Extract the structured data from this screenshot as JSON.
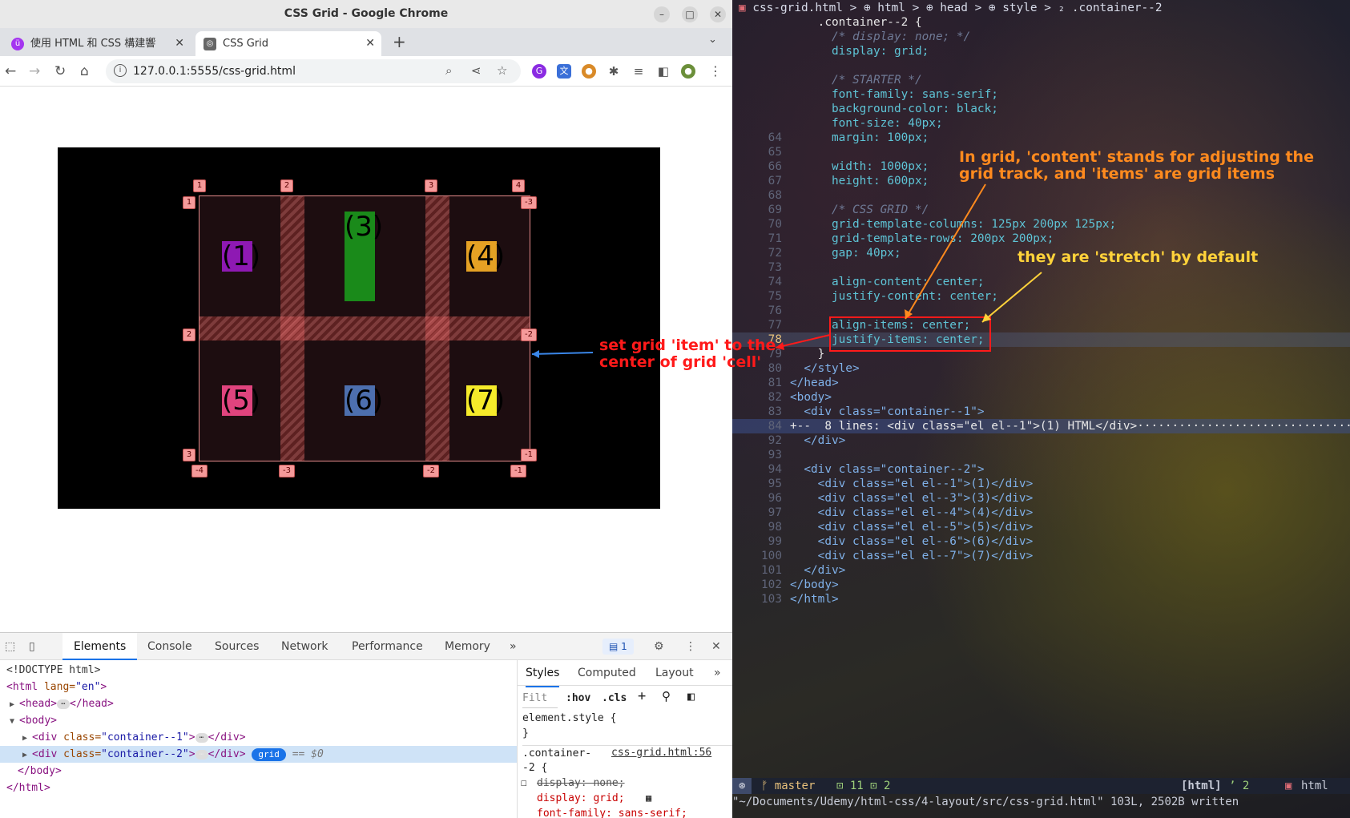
{
  "window": {
    "title": "CSS Grid - Google Chrome"
  },
  "tabs": [
    {
      "label": "使用 HTML 和 CSS 構建響",
      "icon": "udemy-icon"
    },
    {
      "label": "CSS Grid",
      "icon": "page-icon"
    }
  ],
  "address_bar": {
    "url": "127.0.0.1:5555/css-grid.html"
  },
  "grid_items": [
    {
      "label": "(1)",
      "color": "#8e19b3"
    },
    {
      "label": "(3)",
      "color": "#1a8a1a"
    },
    {
      "label": "(4)",
      "color": "#e5a124"
    },
    {
      "label": "(5)",
      "color": "#e0447e"
    },
    {
      "label": "(6)",
      "color": "#4d6fae"
    },
    {
      "label": "(7)",
      "color": "#f5ea2a"
    }
  ],
  "grid_numbers": {
    "top": [
      "1",
      "2",
      "3",
      "4"
    ],
    "left": [
      "1",
      "2",
      "3"
    ],
    "right": [
      "-3",
      "-2",
      "-1"
    ],
    "bottom": [
      "-4",
      "-3",
      "-2",
      "-1"
    ]
  },
  "devtools": {
    "tabs": [
      "Elements",
      "Console",
      "Sources",
      "Network",
      "Performance",
      "Memory"
    ],
    "issues_count": "1",
    "dom": {
      "doctype": "<!DOCTYPE html>",
      "html_open": "<html",
      "html_lang_attr": " lang=",
      "html_lang_val": "\"en\"",
      "html_close_bracket": ">",
      "head": "<head>",
      "head_close": "</head>",
      "body": "<body>",
      "div1_open": "<div",
      "div_class_attr": " class=",
      "div1_class": "\"container--1\"",
      "div2_class": "\"container--2\"",
      "div_close_bracket": ">",
      "div_end": "</div>",
      "grid_badge": "grid",
      "dollar0": "== $0",
      "body_close": "</body>",
      "html_close": "</html>"
    },
    "styles_tabs": [
      "Styles",
      "Computed",
      "Layout"
    ],
    "filter_placeholder": "Filt",
    "hov": ":hov",
    "cls": ".cls",
    "element_style": "element.style {",
    "close_brace": "}",
    "rule_selector_1": ".container-",
    "rule_selector_2": "-2 {",
    "rule_source": "css-grid.html:56",
    "decl_display_none": "display: none;",
    "decl_display_grid": "display: grid;",
    "decl_font_family": "font-family: sans-serif;"
  },
  "editor": {
    "breadcrumb": "css-grid.html > ⊕ html > ⊕ head > ⊕ style > ₂ .container--2",
    "lines": [
      {
        "n": "",
        "t": "    .container--2 {",
        "k": "sel"
      },
      {
        "n": "",
        "t": "      /* display: none; */",
        "k": "cmt"
      },
      {
        "n": "",
        "t": "      display: grid;",
        "k": "decl"
      },
      {
        "n": "",
        "t": "",
        "k": "plain"
      },
      {
        "n": "",
        "t": "      /* STARTER */",
        "k": "cmt"
      },
      {
        "n": "",
        "t": "      font-family: sans-serif;",
        "k": "decl"
      },
      {
        "n": "",
        "t": "      background-color: black;",
        "k": "decl"
      },
      {
        "n": "",
        "t": "      font-size: 40px;",
        "k": "decl"
      },
      {
        "n": "64",
        "t": "      margin: 100px;",
        "k": "decl"
      },
      {
        "n": "65",
        "t": "",
        "k": "plain"
      },
      {
        "n": "66",
        "t": "      width: 1000px;",
        "k": "decl"
      },
      {
        "n": "67",
        "t": "      height: 600px;",
        "k": "decl"
      },
      {
        "n": "68",
        "t": "",
        "k": "plain"
      },
      {
        "n": "69",
        "t": "      /* CSS GRID */",
        "k": "cmt"
      },
      {
        "n": "70",
        "t": "      grid-template-columns: 125px 200px 125px;",
        "k": "decl"
      },
      {
        "n": "71",
        "t": "      grid-template-rows: 200px 200px;",
        "k": "decl"
      },
      {
        "n": "72",
        "t": "      gap: 40px;",
        "k": "decl"
      },
      {
        "n": "73",
        "t": "",
        "k": "plain"
      },
      {
        "n": "74",
        "t": "      align-content: center;",
        "k": "decl"
      },
      {
        "n": "75",
        "t": "      justify-content: center;",
        "k": "decl"
      },
      {
        "n": "76",
        "t": "",
        "k": "plain"
      },
      {
        "n": "77",
        "t": "      align-items: center;",
        "k": "decl"
      },
      {
        "n": "78",
        "t": "      justify-items: center;",
        "k": "cur"
      },
      {
        "n": "79",
        "t": "    }",
        "k": "sel"
      },
      {
        "n": "80",
        "t": "  </style>",
        "k": "html"
      },
      {
        "n": "81",
        "t": "</head>",
        "k": "html"
      },
      {
        "n": "82",
        "t": "<body>",
        "k": "html"
      },
      {
        "n": "83",
        "t": "  <div class=\"container--1\">",
        "k": "html"
      },
      {
        "n": "84",
        "t": "+--  8 lines: <div class=\"el el--1\">(1) HTML</div>·····································",
        "k": "fold"
      },
      {
        "n": "92",
        "t": "  </div>",
        "k": "html"
      },
      {
        "n": "93",
        "t": "",
        "k": "plain"
      },
      {
        "n": "94",
        "t": "  <div class=\"container--2\">",
        "k": "html"
      },
      {
        "n": "95",
        "t": "    <div class=\"el el--1\">(1)</div>",
        "k": "html"
      },
      {
        "n": "96",
        "t": "    <div class=\"el el--3\">(3)</div>",
        "k": "html"
      },
      {
        "n": "97",
        "t": "    <div class=\"el el--4\">(4)</div>",
        "k": "html"
      },
      {
        "n": "98",
        "t": "    <div class=\"el el--5\">(5)</div>",
        "k": "html"
      },
      {
        "n": "99",
        "t": "    <div class=\"el el--6\">(6)</div>",
        "k": "html"
      },
      {
        "n": "100",
        "t": "    <div class=\"el el--7\">(7)</div>",
        "k": "html"
      },
      {
        "n": "101",
        "t": "  </div>",
        "k": "html"
      },
      {
        "n": "102",
        "t": "</body>",
        "k": "html"
      },
      {
        "n": "103",
        "t": "</html>",
        "k": "html"
      }
    ],
    "status": {
      "mode": "⊛",
      "branch": "ᚠ master",
      "diag": "⊡ 11 ⊡ 2",
      "filetype_tag": "[html]",
      "right_extra": "ʼ 2",
      "filetype": "html"
    },
    "cmdline": "\"~/Documents/Udemy/html-css/4-layout/src/css-grid.html\" 103L, 2502B written"
  },
  "annotations": {
    "content_vs_items_1": "In grid, 'content' stands for adjusting the",
    "content_vs_items_2": "grid track, and 'items' are grid items",
    "stretch_default": "they are 'stretch' by default",
    "set_item_center_1": "set grid 'item' to the",
    "set_item_center_2": "center of grid 'cell'"
  },
  "colors": {
    "annotation_orange": "#ff8a1e",
    "annotation_yellow": "#ffd23a",
    "annotation_red": "#ff1a1a",
    "selection_blue": "#1a73e8"
  }
}
